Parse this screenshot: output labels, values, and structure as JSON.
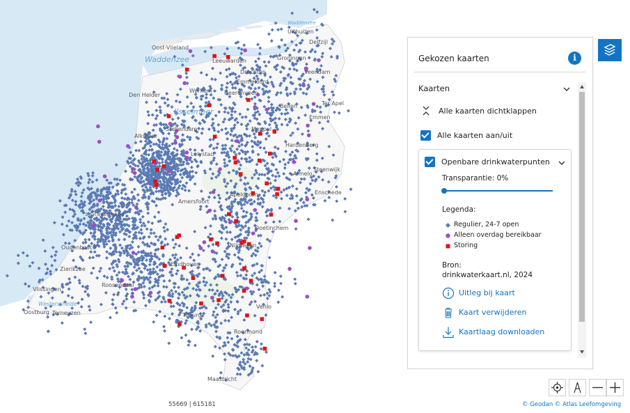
{
  "map": {
    "water_labels": [
      "Waddenzee",
      "IJsselmeer",
      "Westerschelde",
      "Waddenzee"
    ],
    "places": [
      "Uithuizen",
      "Delfzijl",
      "Oost-Vlieland",
      "Leeuwarden",
      "Drachten",
      "Groningen",
      "Veendam",
      "Den Helder",
      "Workum",
      "Heerenveen",
      "Beilen",
      "Ter Apel",
      "Emmen",
      "Stellendam",
      "Meppel",
      "Hardenberg",
      "Lelystad",
      "Almelo",
      "Enschede",
      "Amersfoort",
      "'s-Gravenhage",
      "Apeldoorn",
      "Doetinchem",
      "Oudenbosch",
      "Zierikzee",
      "Vlissingen",
      "Oostburg",
      "Terneuzen",
      "Roosendaal",
      "Venlo",
      "Eindhoven",
      "Tilburg",
      "Maastricht",
      "Roermond",
      "Alkmaar",
      "Nijmegen",
      "Steenwijk",
      "Emmeloord"
    ],
    "coordinate_readout": "55669 | 615181",
    "attribution": "© Geodan © Atlas Leefomgeving",
    "colors": {
      "regular": "#5a7ab4",
      "daytime": "#9b4fc4",
      "fault": "#e01414",
      "water": "#d8e9f6",
      "land": "#f7f7f7"
    }
  },
  "panel": {
    "title": "Gekozen kaarten",
    "info_icon": "info-icon",
    "section_label": "Kaarten",
    "collapse_all": "Alle kaarten dichtklappen",
    "toggle_all": "Alle kaarten aan/uit",
    "layer": {
      "title": "Openbare drinkwaterpunten",
      "transparency_label": "Transparantie: 0%",
      "transparency_value": 0,
      "legend_title": "Legenda:",
      "legend": [
        {
          "label": "Regulier, 24-7 open",
          "symbol": "diamond",
          "color": "#5a7ab4"
        },
        {
          "label": "Alleen overdag bereikbaar",
          "symbol": "circle",
          "color": "#9b4fc4"
        },
        {
          "label": "Storing",
          "symbol": "square",
          "color": "#e01414"
        }
      ],
      "source_title": "Bron:",
      "source_value": "drinkwaterkaart.nl, 2024",
      "actions": [
        {
          "label": "Uitleg bij kaart",
          "icon": "info-circle-icon"
        },
        {
          "label": "Kaart verwijderen",
          "icon": "trash-icon"
        },
        {
          "label": "Kaartlaag downloaden",
          "icon": "download-icon"
        }
      ]
    }
  },
  "controls": {
    "layers_icon": "layers-icon",
    "locate_icon": "locate-icon",
    "north_icon": "north-arrow-icon",
    "zoom_out_icon": "zoom-out-icon",
    "zoom_in_icon": "zoom-in-icon"
  }
}
